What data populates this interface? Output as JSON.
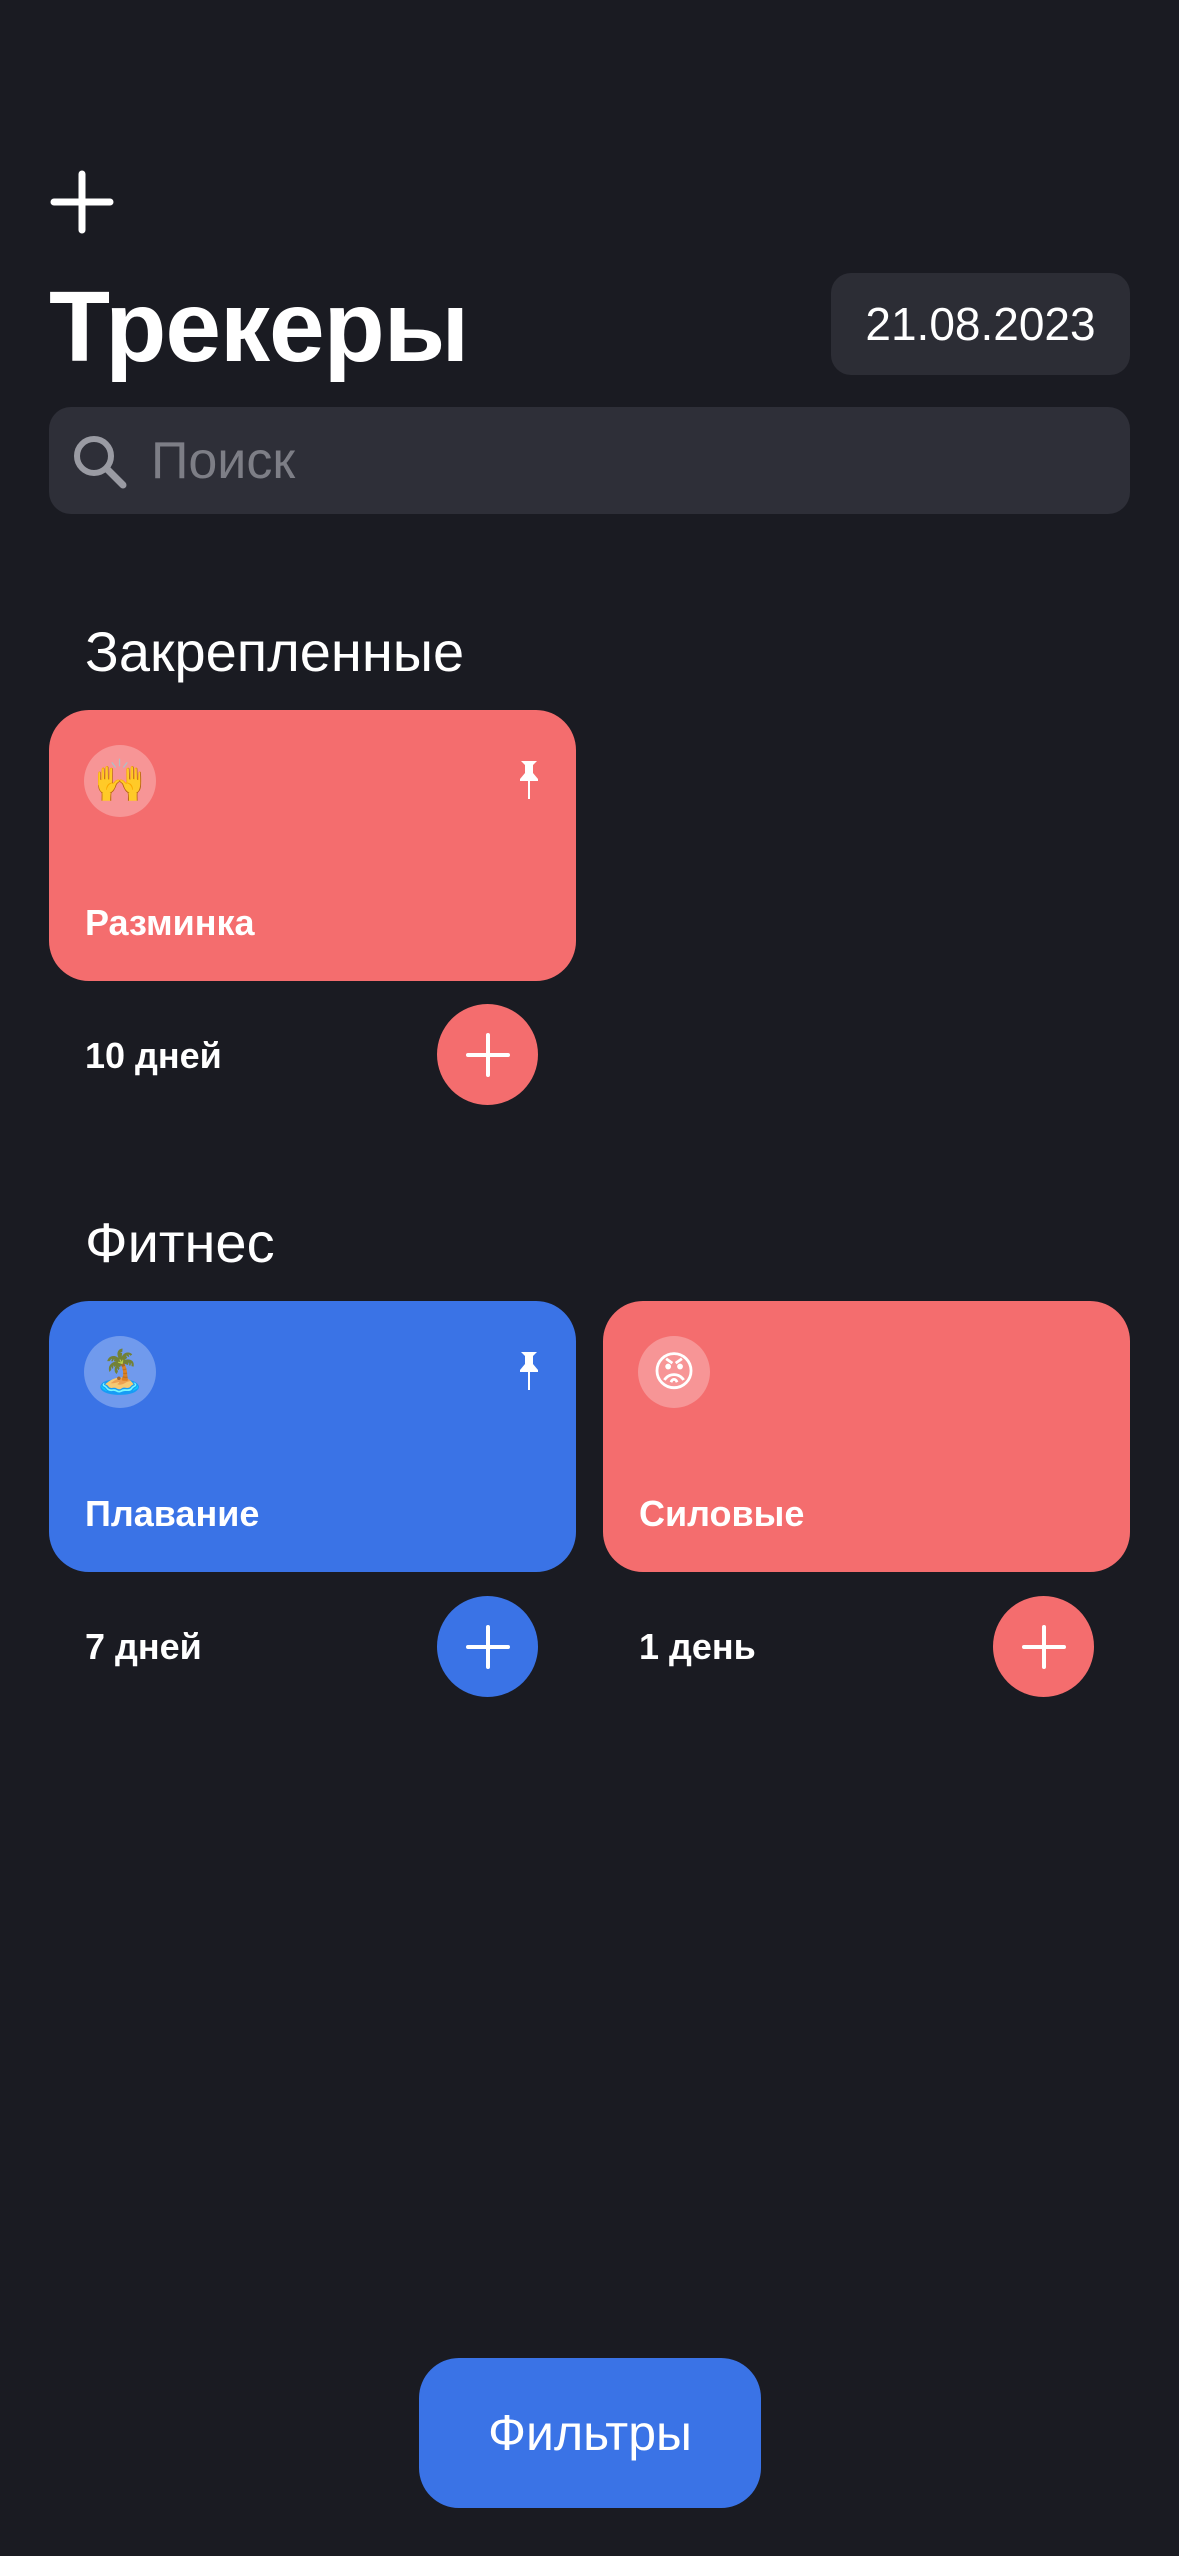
{
  "header": {
    "add_icon": "plus-icon",
    "title": "Трекеры",
    "date": "21.08.2023"
  },
  "search": {
    "placeholder": "Поиск",
    "icon": "search-icon"
  },
  "sections": [
    {
      "title": "Закрепленные",
      "trackers": [
        {
          "name": "Разминка",
          "emoji": "🙌",
          "pinned": true,
          "count_label": "10 дней",
          "color": "#f46d6e"
        }
      ]
    },
    {
      "title": "Фитнес",
      "trackers": [
        {
          "name": "Плавание",
          "emoji": "🏝️",
          "pinned": true,
          "count_label": "7 дней",
          "color": "#3a73e6"
        },
        {
          "name": "Силовые",
          "emoji": "😡",
          "pinned": false,
          "count_label": "1 день",
          "color": "#f46d6e"
        }
      ]
    }
  ],
  "filters": {
    "label": "Фильтры",
    "color": "#3a73e6"
  },
  "colors": {
    "background": "#1a1b22",
    "surface": "#2e2f38",
    "red": "#f46d6e",
    "blue": "#3a73e6"
  }
}
